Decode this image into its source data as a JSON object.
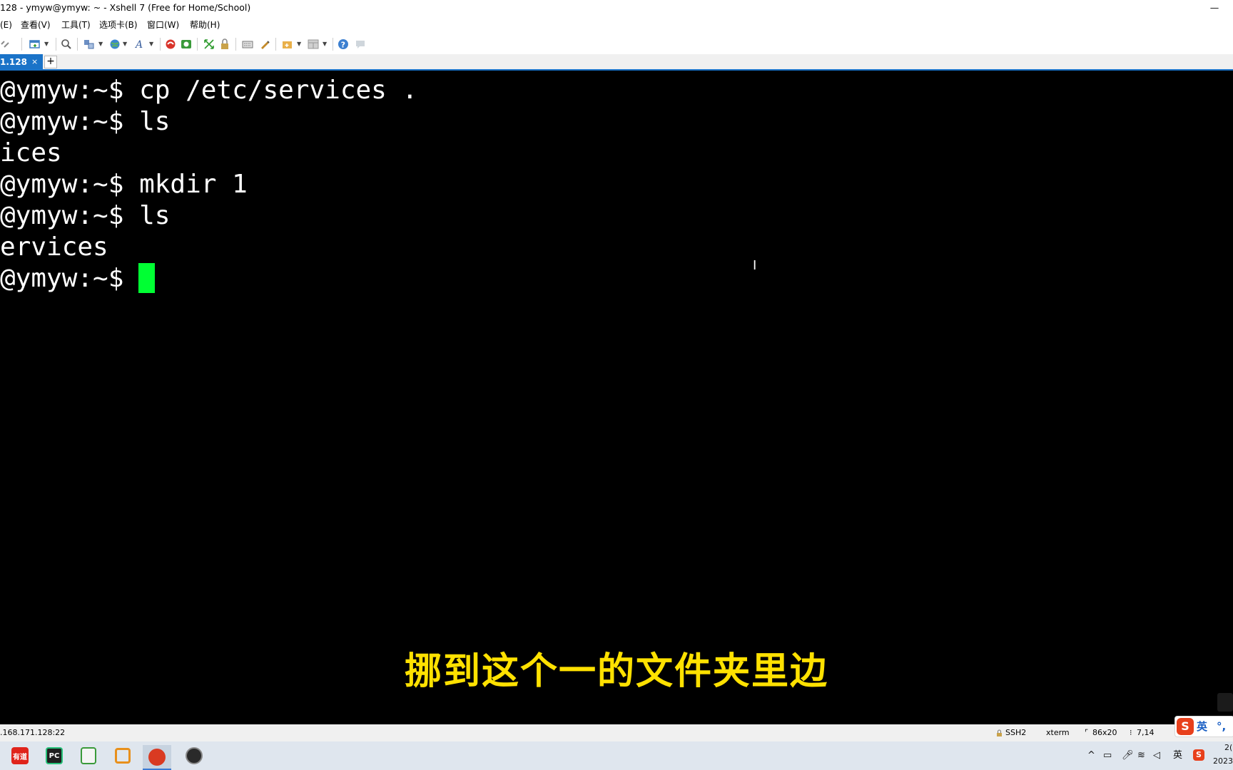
{
  "window": {
    "title": "128 - ymyw@ymyw: ~ - Xshell 7 (Free for Home/School)",
    "minimize_glyph": "—"
  },
  "menu": [
    {
      "label": "(E)"
    },
    {
      "label": "查看(V)"
    },
    {
      "label": "工具(T)"
    },
    {
      "label": "选项卡(B)"
    },
    {
      "label": "窗口(W)"
    },
    {
      "label": "帮助(H)"
    }
  ],
  "toolbar_icons": [
    "link-icon",
    "new-session-icon",
    "find-icon",
    "transfer-icon",
    "globe-icon",
    "font-icon",
    "xftp-icon",
    "xmanager-icon",
    "fullscreen-icon",
    "lock-icon",
    "keyboard-icon",
    "script-icon",
    "compose-icon",
    "layout-icon",
    "help-icon",
    "chat-icon"
  ],
  "tabs": {
    "active_label": "1.128",
    "close_glyph": "×",
    "add_glyph": "+"
  },
  "terminal": {
    "lines": [
      "@ymyw:~$ cp /etc/services .",
      "@ymyw:~$ ls",
      "ices",
      "@ymyw:~$ mkdir 1",
      "@ymyw:~$ ls",
      "ervices",
      "@ymyw:~$ "
    ],
    "cursor_color": "#00ff33",
    "ibeam_glyph": "I"
  },
  "subtitle": "挪到这个一的文件夹里边",
  "status": {
    "host": ".168.171.128:22",
    "protocol": "SSH2",
    "terminal_type": "xterm",
    "size": "86x20",
    "cursor_pos": "7,14"
  },
  "ime": {
    "logo": "S",
    "lang": "英",
    "punct": "°,"
  },
  "taskbar": {
    "apps": [
      {
        "name": "youdao",
        "label": "有道",
        "color": "#e0241b"
      },
      {
        "name": "pycharm",
        "label": "PC",
        "color": "#1f1f1f"
      },
      {
        "name": "notepad",
        "label": "",
        "color": "#3a9a3a"
      },
      {
        "name": "vmware",
        "label": "",
        "color": "#e8901c"
      },
      {
        "name": "xshell",
        "label": "",
        "color": "#d93a22"
      },
      {
        "name": "obs",
        "label": "",
        "color": "#2a2a2a"
      }
    ],
    "tray": {
      "caret": "^",
      "lang": "英",
      "time": "2(",
      "date": "2023"
    }
  },
  "colors": {
    "accent": "#1a73c8",
    "subtitle": "#ffe100",
    "terminal_bg": "#000000"
  }
}
